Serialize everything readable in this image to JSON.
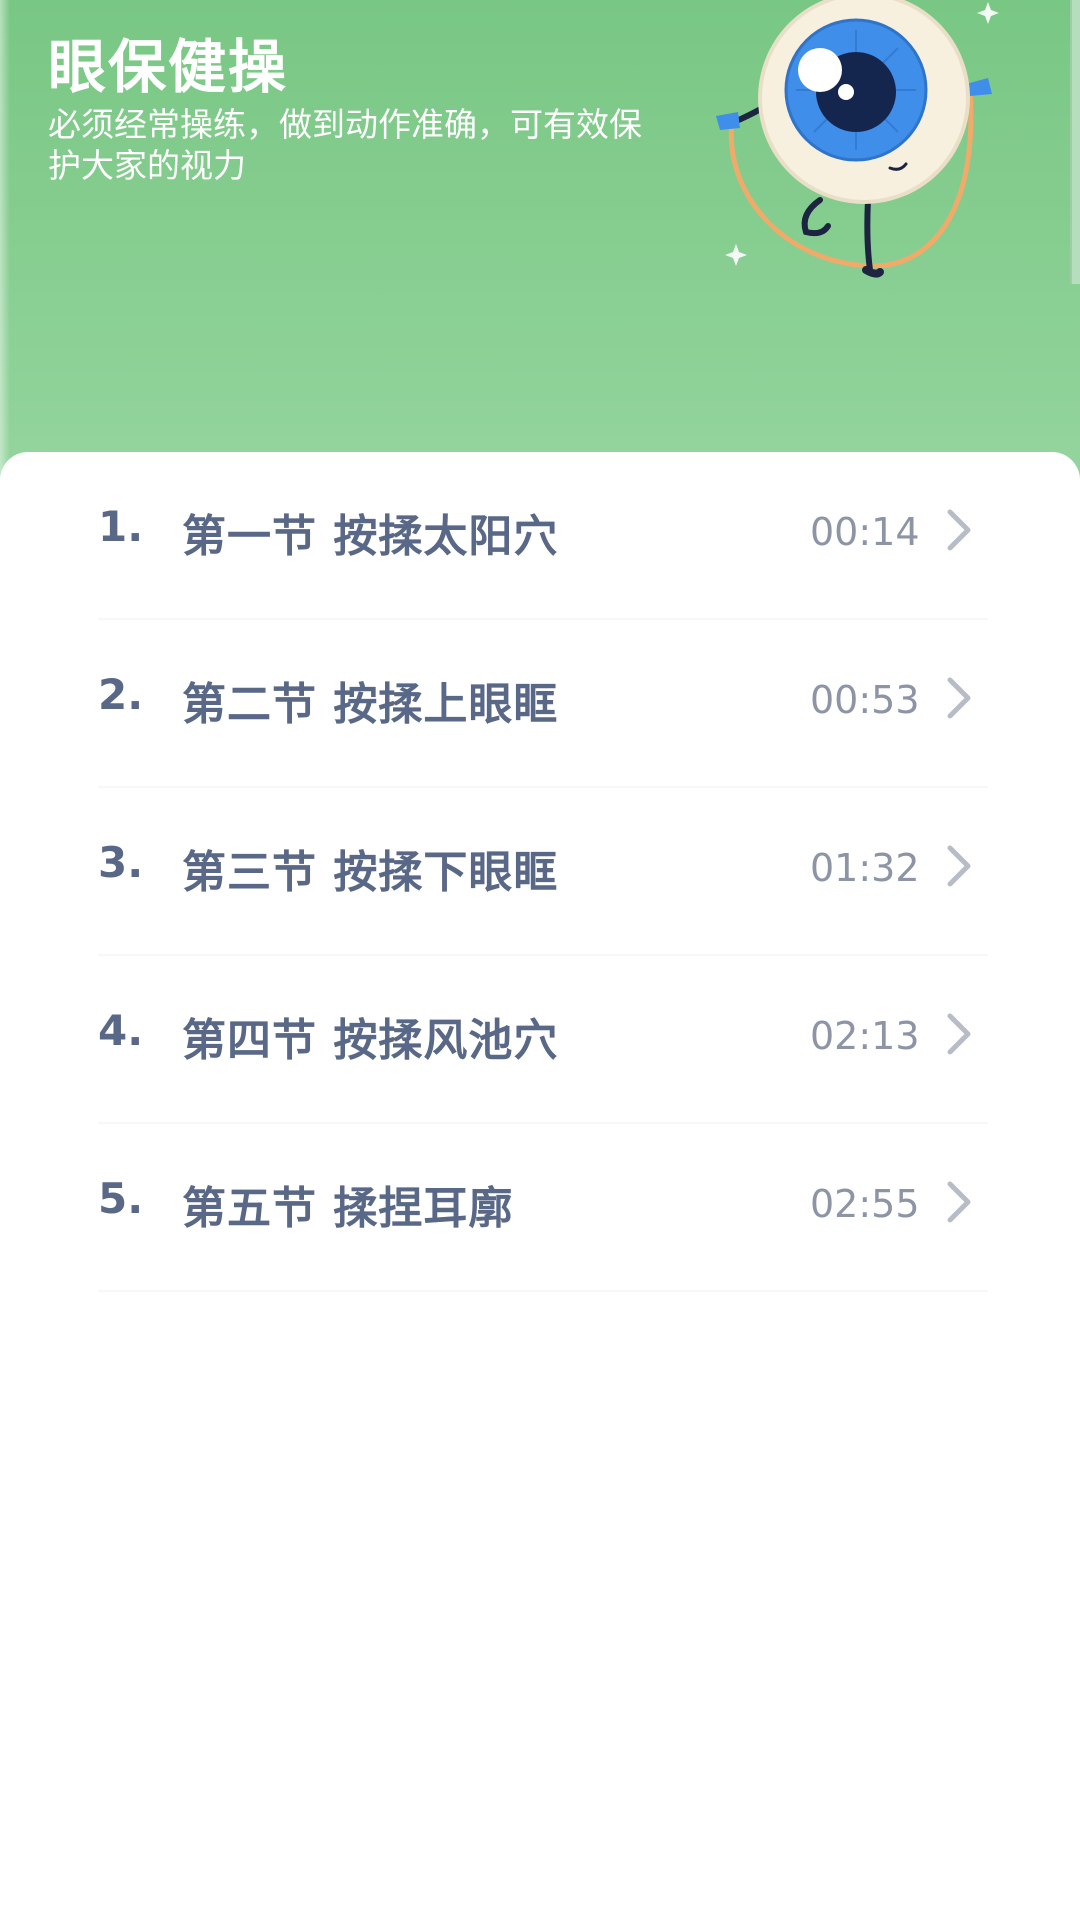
{
  "header": {
    "title": "眼保健操",
    "subtitle": "必须经常操练，做到动作准确，可有效保护大家的视力"
  },
  "mascot": {
    "icon": "eyeball-mascot-jump-rope",
    "colors": {
      "iris": "#3f8eea",
      "pupil": "#14264e",
      "sclera": "#f7f0de",
      "rope": "#f0ab6a"
    }
  },
  "list": {
    "items": [
      {
        "number": "1.",
        "label": "第一节 按揉太阳穴",
        "duration": "00:14"
      },
      {
        "number": "2.",
        "label": "第二节 按揉上眼眶",
        "duration": "00:53"
      },
      {
        "number": "3.",
        "label": "第三节 按揉下眼眶",
        "duration": "01:32"
      },
      {
        "number": "4.",
        "label": "第四节 按揉风池穴",
        "duration": "02:13"
      },
      {
        "number": "5.",
        "label": "第五节 揉捏耳廓",
        "duration": "02:55"
      }
    ]
  },
  "colors": {
    "header_green": "#7ec98a",
    "text_primary": "#5a6887",
    "text_secondary": "#8d94a6",
    "chevron": "#b8bcc6"
  }
}
